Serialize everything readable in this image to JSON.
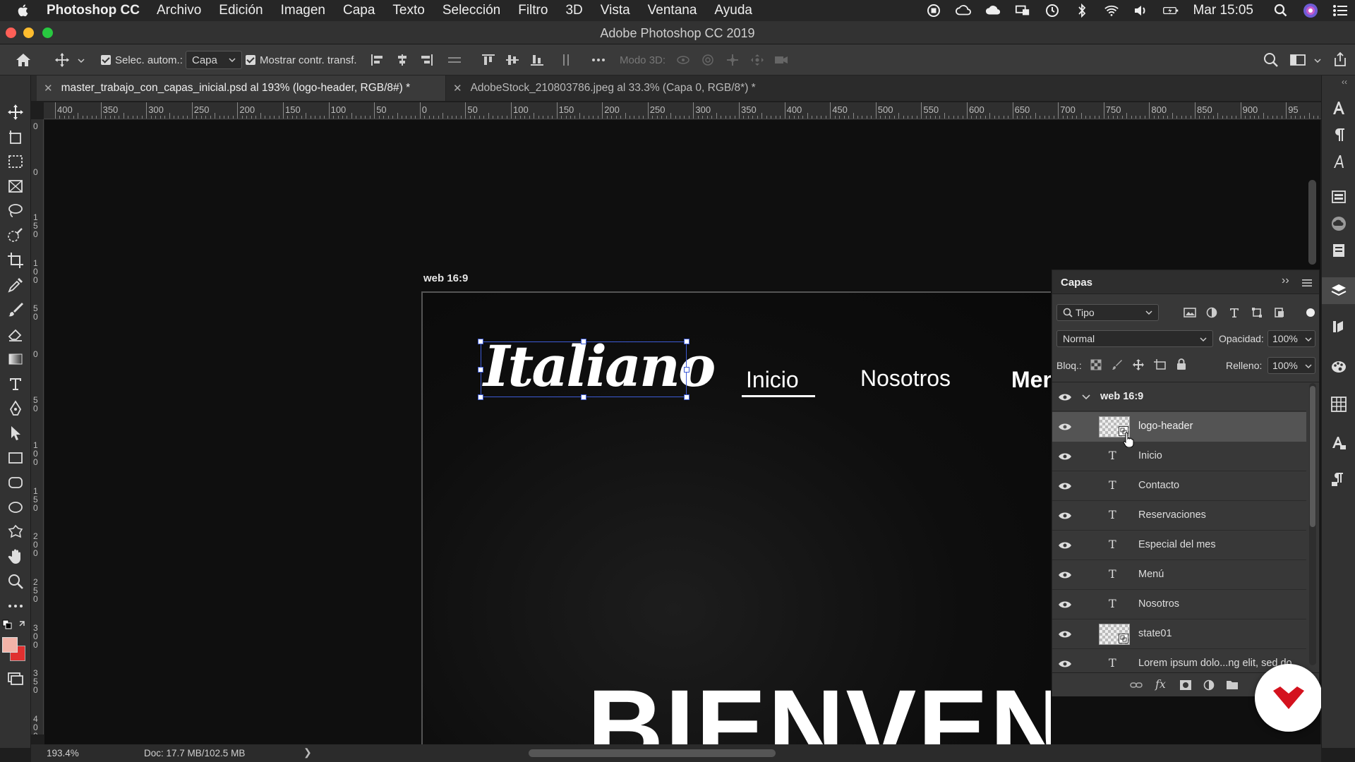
{
  "menubar": {
    "app_name": "Photoshop CC",
    "items": [
      "Archivo",
      "Edición",
      "Imagen",
      "Capa",
      "Texto",
      "Selección",
      "Filtro",
      "3D",
      "Vista",
      "Ventana",
      "Ayuda"
    ],
    "clock": "Mar 15:05"
  },
  "window": {
    "title": "Adobe Photoshop CC 2019"
  },
  "options": {
    "auto_select_label": "Selec. autom.:",
    "auto_select_value": "Capa",
    "show_transform_label": "Mostrar contr. transf.",
    "mode_3d_label": "Modo 3D:"
  },
  "tabs": [
    {
      "label": "master_trabajo_con_capas_inicial.psd al 193% (logo-header, RGB/8#) *",
      "active": true
    },
    {
      "label": "AdobeStock_210803786.jpeg al 33.3% (Capa 0, RGB/8*) *",
      "active": false
    }
  ],
  "ruler": {
    "h_labels": [
      "400",
      "350",
      "300",
      "250",
      "200",
      "150",
      "100",
      "50",
      "0",
      "50",
      "100",
      "150",
      "200",
      "250",
      "300",
      "350",
      "400",
      "450",
      "500",
      "550",
      "600",
      "650",
      "700",
      "750",
      "800",
      "850",
      "900",
      "95"
    ],
    "v_labels": [
      "0",
      "0",
      "1\n5\n0",
      "1\n0\n0",
      "5\n0",
      "0",
      "5\n0",
      "1\n0\n0",
      "1\n5\n0",
      "2\n0\n0",
      "2\n5\n0",
      "3\n0\n0",
      "3\n5\n0",
      "4\n0\n0",
      "4\n5\n0"
    ]
  },
  "artboard": {
    "label": "web 16:9",
    "logo_text": "Italiano",
    "nav": [
      "Inicio",
      "Nosotros",
      "Men"
    ],
    "hero_text": "BIENVENIDO"
  },
  "layers_panel": {
    "title": "Capas",
    "filter_kind": "Tipo",
    "blend_mode": "Normal",
    "opacity_label": "Opacidad:",
    "opacity_value": "100%",
    "lock_label": "Bloq.:",
    "fill_label": "Relleno:",
    "fill_value": "100%",
    "group_name": "web 16:9",
    "layers": [
      {
        "name": "logo-header",
        "type": "smart",
        "selected": true
      },
      {
        "name": "Inicio",
        "type": "text"
      },
      {
        "name": "Contacto",
        "type": "text"
      },
      {
        "name": "Reservaciones",
        "type": "text"
      },
      {
        "name": "Especial del mes",
        "type": "text"
      },
      {
        "name": "Menú",
        "type": "text"
      },
      {
        "name": "Nosotros",
        "type": "text"
      },
      {
        "name": "state01",
        "type": "smart"
      },
      {
        "name": "Lorem ipsum dolo...ng elit, sed do",
        "type": "text"
      }
    ],
    "footer_fx": "fx"
  },
  "status": {
    "zoom": "193.4%",
    "doc": "Doc: 17.7 MB/102.5 MB"
  },
  "colors": {
    "foreground": "#f3b3a8",
    "background": "#e03030",
    "brand_badge": "#d4121e",
    "selection": "#3d5bd6"
  }
}
